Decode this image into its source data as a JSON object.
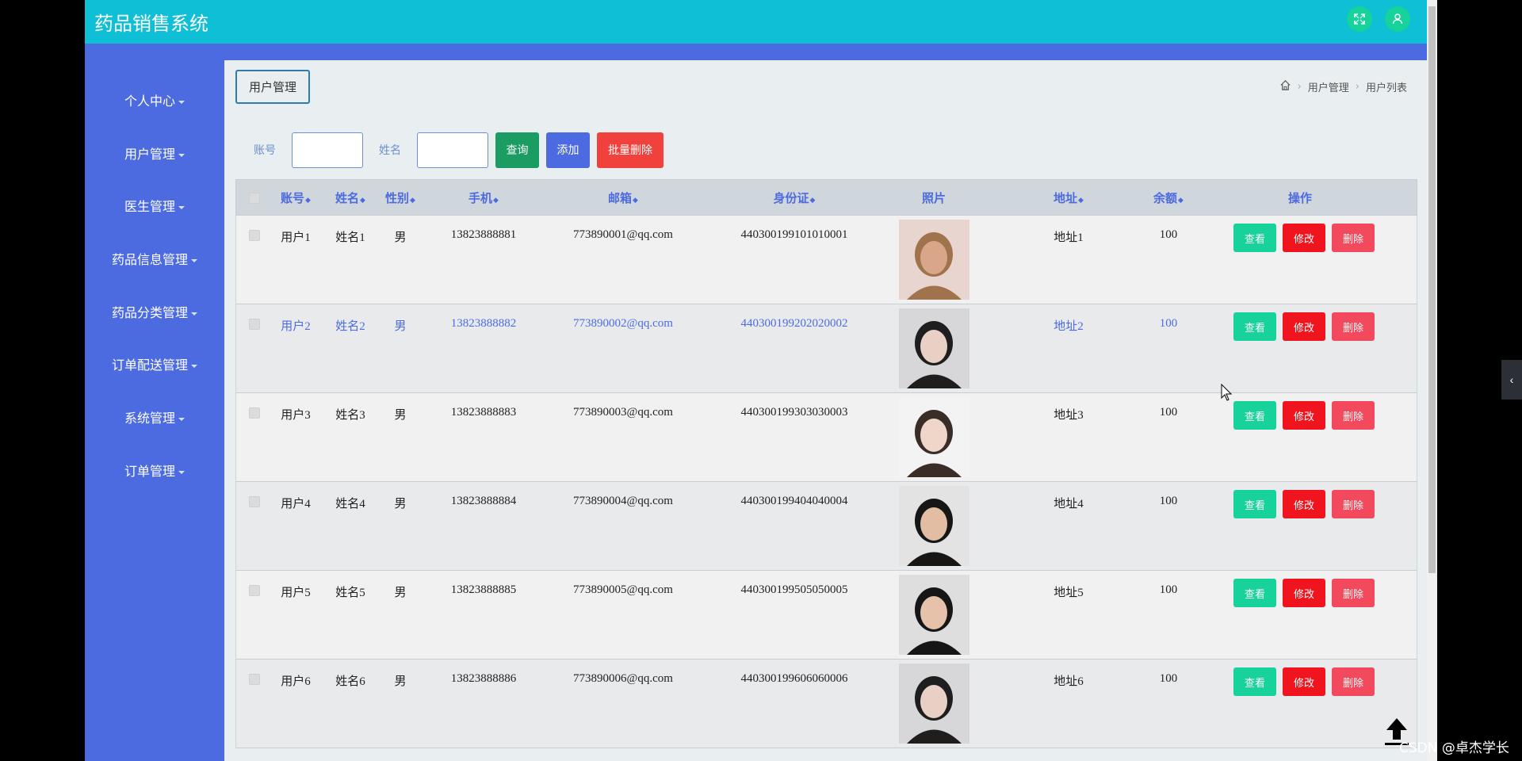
{
  "app": {
    "title": "药品销售系统"
  },
  "header": {
    "fullscreen_icon": "fullscreen-icon",
    "user_icon": "user-icon"
  },
  "sidebar": {
    "items": [
      {
        "label": "个人中心"
      },
      {
        "label": "用户管理"
      },
      {
        "label": "医生管理"
      },
      {
        "label": "药品信息管理"
      },
      {
        "label": "药品分类管理"
      },
      {
        "label": "订单配送管理"
      },
      {
        "label": "系统管理"
      },
      {
        "label": "订单管理"
      }
    ]
  },
  "page": {
    "tab_label": "用户管理",
    "breadcrumb": {
      "home_icon": "home-icon",
      "level1": "用户管理",
      "level2": "用户列表"
    }
  },
  "search": {
    "account_label": "账号",
    "account_value": "",
    "name_label": "姓名",
    "name_value": "",
    "query_label": "查询",
    "add_label": "添加",
    "batch_delete_label": "批量删除"
  },
  "colors": {
    "topbar": "#0fbfd6",
    "sidebar": "#4d6be0",
    "query": "#1a9c62",
    "add": "#4d6be0",
    "batch_delete": "#f0413c",
    "view": "#17d29a",
    "edit": "#f0141e",
    "delete": "#f2495c"
  },
  "table": {
    "headers": {
      "account": "账号",
      "name": "姓名",
      "gender": "性别",
      "phone": "手机",
      "email": "邮箱",
      "idcard": "身份证",
      "photo": "照片",
      "address": "地址",
      "balance": "余额",
      "actions": "操作"
    },
    "action_labels": {
      "view": "查看",
      "edit": "修改",
      "delete": "删除"
    },
    "rows": [
      {
        "account": "用户1",
        "name": "姓名1",
        "gender": "男",
        "phone": "13823888881",
        "email": "773890001@qq.com",
        "idcard": "440300199101010001",
        "address": "地址1",
        "balance": "100"
      },
      {
        "account": "用户2",
        "name": "姓名2",
        "gender": "男",
        "phone": "13823888882",
        "email": "773890002@qq.com",
        "idcard": "440300199202020002",
        "address": "地址2",
        "balance": "100"
      },
      {
        "account": "用户3",
        "name": "姓名3",
        "gender": "男",
        "phone": "13823888883",
        "email": "773890003@qq.com",
        "idcard": "440300199303030003",
        "address": "地址3",
        "balance": "100"
      },
      {
        "account": "用户4",
        "name": "姓名4",
        "gender": "男",
        "phone": "13823888884",
        "email": "773890004@qq.com",
        "idcard": "440300199404040004",
        "address": "地址4",
        "balance": "100"
      },
      {
        "account": "用户5",
        "name": "姓名5",
        "gender": "男",
        "phone": "13823888885",
        "email": "773890005@qq.com",
        "idcard": "440300199505050005",
        "address": "地址5",
        "balance": "100"
      },
      {
        "account": "用户6",
        "name": "姓名6",
        "gender": "男",
        "phone": "13823888886",
        "email": "773890006@qq.com",
        "idcard": "440300199606060006",
        "address": "地址6",
        "balance": "100"
      }
    ]
  },
  "watermark": "CSDN @卓杰学长"
}
